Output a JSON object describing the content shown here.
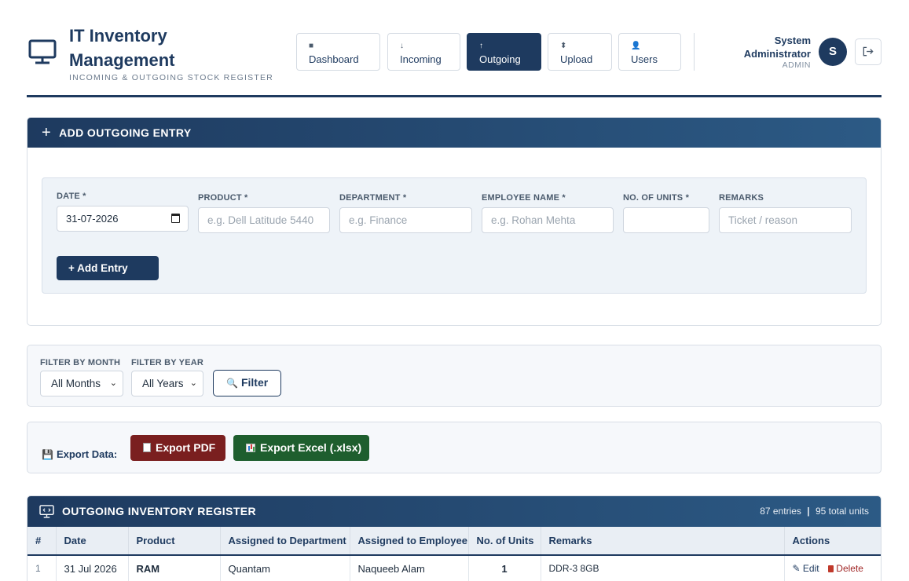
{
  "app": {
    "title": "IT Inventory Management",
    "subtitle": "INCOMING & OUTGOING STOCK REGISTER"
  },
  "nav": [
    {
      "label": "Dashboard",
      "icon": "■",
      "active": false
    },
    {
      "label": "Incoming",
      "icon": "↓",
      "active": false
    },
    {
      "label": "Outgoing",
      "icon": "↑",
      "active": true
    },
    {
      "label": "Upload",
      "icon": "⬍",
      "active": false
    },
    {
      "label": "Users",
      "icon": "👤",
      "active": false
    }
  ],
  "user": {
    "name": "System Administrator",
    "role": "ADMIN",
    "initial": "S",
    "logout_icon": "⇥"
  },
  "add_entry": {
    "title": "ADD OUTGOING ENTRY",
    "icon": "+",
    "date_label": "DATE *",
    "date_value": "31-07-2026",
    "product_label": "PRODUCT *",
    "product_placeholder": "e.g. Dell Latitude 5440",
    "department_label": "DEPARTMENT *",
    "department_placeholder": "e.g. Finance",
    "employee_label": "EMPLOYEE NAME *",
    "employee_placeholder": "e.g. Rohan Mehta",
    "units_label": "NO. OF UNITS *",
    "units_value": "",
    "remarks_label": "REMARKS",
    "remarks_placeholder": "Ticket / reason",
    "submit_label": "+ Add Entry"
  },
  "filter": {
    "month_label": "FILTER BY MONTH",
    "month_value": "All Months",
    "year_label": "FILTER BY YEAR",
    "year_value": "All Years",
    "button_label": "Filter",
    "button_icon": "🔍"
  },
  "export": {
    "label": "Export Data:",
    "label_icon": "💾",
    "pdf_label": "Export PDF",
    "excel_label": "Export Excel (.xlsx)"
  },
  "register": {
    "title": "OUTGOING INVENTORY REGISTER",
    "entries": "87 entries",
    "separator": "|",
    "units": "95 total units",
    "columns": [
      "#",
      "Date",
      "Product",
      "Assigned to Department",
      "Assigned to Employee",
      "No. of Units",
      "Remarks",
      "Actions"
    ],
    "rows": [
      {
        "num": "1",
        "date": "31 Jul 2026",
        "product": "RAM",
        "department": "Quantam",
        "employee": "Naqueeb Alam",
        "units": "1",
        "remarks": "DDR-3 8GB",
        "edit_label": "Edit",
        "delete_label": "Delete"
      }
    ]
  }
}
